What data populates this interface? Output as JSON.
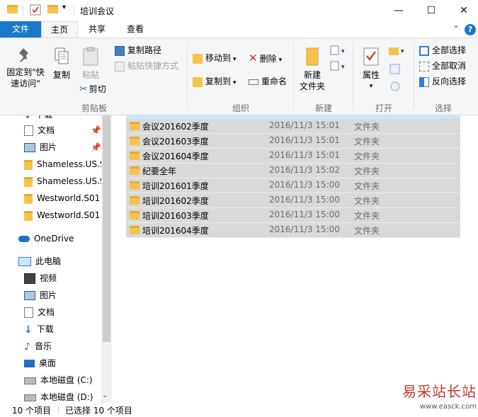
{
  "window": {
    "title": "培训会议",
    "minimize": "—",
    "maximize": "☐",
    "close": "✕"
  },
  "ribbon": {
    "tabs": {
      "file": "文件",
      "home": "主页",
      "share": "共享",
      "view": "查看"
    },
    "help": "?",
    "collapse": "⌃",
    "clipboard": {
      "pin_label_1": "固定到\"快",
      "pin_label_2": "速访问\"",
      "copy": "复制",
      "paste": "粘贴",
      "copy_path": "复制路径",
      "paste_shortcut": "粘贴快捷方式",
      "cut": "剪切",
      "group": "剪贴板"
    },
    "organize": {
      "move_to": "移动到",
      "copy_to": "复制到",
      "delete": "删除",
      "rename": "重命名",
      "group": "组织"
    },
    "new": {
      "new_folder_1": "新建",
      "new_folder_2": "文件夹",
      "group": "新建"
    },
    "open": {
      "properties": "属性",
      "group": "打开"
    },
    "select": {
      "select_all": "全部选择",
      "select_none": "全部取消",
      "invert": "反向选择",
      "group": "选择"
    }
  },
  "nav": {
    "items": [
      {
        "label": "下载"
      },
      {
        "label": "文档"
      },
      {
        "label": "图片"
      },
      {
        "label": "Shameless.US.S"
      },
      {
        "label": "Shameless.US.S"
      },
      {
        "label": "Westworld.S01"
      },
      {
        "label": "Westworld.S01"
      },
      {
        "label": "OneDrive"
      },
      {
        "label": "此电脑"
      },
      {
        "label": "视频"
      },
      {
        "label": "图片"
      },
      {
        "label": "文档"
      },
      {
        "label": "下载"
      },
      {
        "label": "音乐"
      },
      {
        "label": "桌面"
      },
      {
        "label": "本地磁盘 (C:)"
      },
      {
        "label": "本地磁盘 (D:)"
      }
    ]
  },
  "files": [
    {
      "name": "会议201602季度",
      "date": "2016/11/3 15:01",
      "type": "文件夹"
    },
    {
      "name": "会议201603季度",
      "date": "2016/11/3 15:01",
      "type": "文件夹"
    },
    {
      "name": "会议201604季度",
      "date": "2016/11/3 15:01",
      "type": "文件夹"
    },
    {
      "name": "纪要全年",
      "date": "2016/11/3 15:02",
      "type": "文件夹"
    },
    {
      "name": "培训201601季度",
      "date": "2016/11/3 15:00",
      "type": "文件夹"
    },
    {
      "name": "培训201602季度",
      "date": "2016/11/3 15:00",
      "type": "文件夹"
    },
    {
      "name": "培训201603季度",
      "date": "2016/11/3 15:00",
      "type": "文件夹"
    },
    {
      "name": "培训201604季度",
      "date": "2016/11/3 15:00",
      "type": "文件夹"
    }
  ],
  "status": {
    "count": "10 个项目",
    "selected": "已选择 10 个项目"
  },
  "watermark": {
    "line1": "易采站长站",
    "line2": "www.easck.com"
  },
  "colors": {
    "accent": "#1979ca",
    "folder": "#f7c24c",
    "selection": "#d9d9d9",
    "watermark": "#c0392b"
  }
}
